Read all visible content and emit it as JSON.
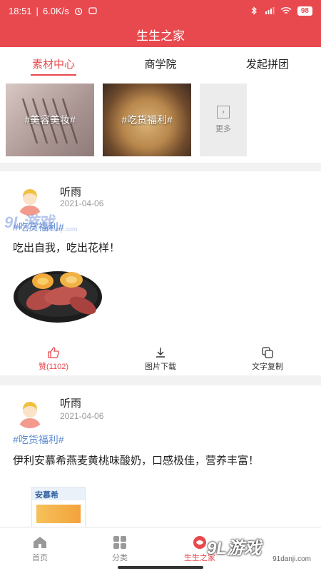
{
  "status": {
    "time": "18:51",
    "speed": "6.0K/s",
    "battery": "98"
  },
  "title": "生生之家",
  "tabs": [
    {
      "label": "素材中心"
    },
    {
      "label": "商学院"
    },
    {
      "label": "发起拼团"
    }
  ],
  "tiles": {
    "beauty": "#美容美妆#",
    "food": "#吃货福利#",
    "more": "更多"
  },
  "posts": [
    {
      "user": "听雨",
      "date": "2021-04-06",
      "tag": "#吃货福利#",
      "text": "吃出自我，吃出花样！",
      "actions": {
        "like": "赞(1102)",
        "download": "图片下载",
        "copy": "文字复制"
      }
    },
    {
      "user": "听雨",
      "date": "2021-04-06",
      "tag": "#吃货福利#",
      "text": "伊利安慕希燕麦黄桃味酸奶，口感极佳，营养丰富！",
      "product_label": "安慕希"
    }
  ],
  "watermark": {
    "big": "9L游戏",
    "small": "91danji.com"
  },
  "bottom_nav": [
    {
      "label": "首页"
    },
    {
      "label": "分类"
    },
    {
      "label": "生生之家"
    }
  ],
  "brand": {
    "big": "9L游戏",
    "small": "91danji.com"
  },
  "colors": {
    "accent": "#e8494f",
    "tag": "#5a8ad0"
  }
}
